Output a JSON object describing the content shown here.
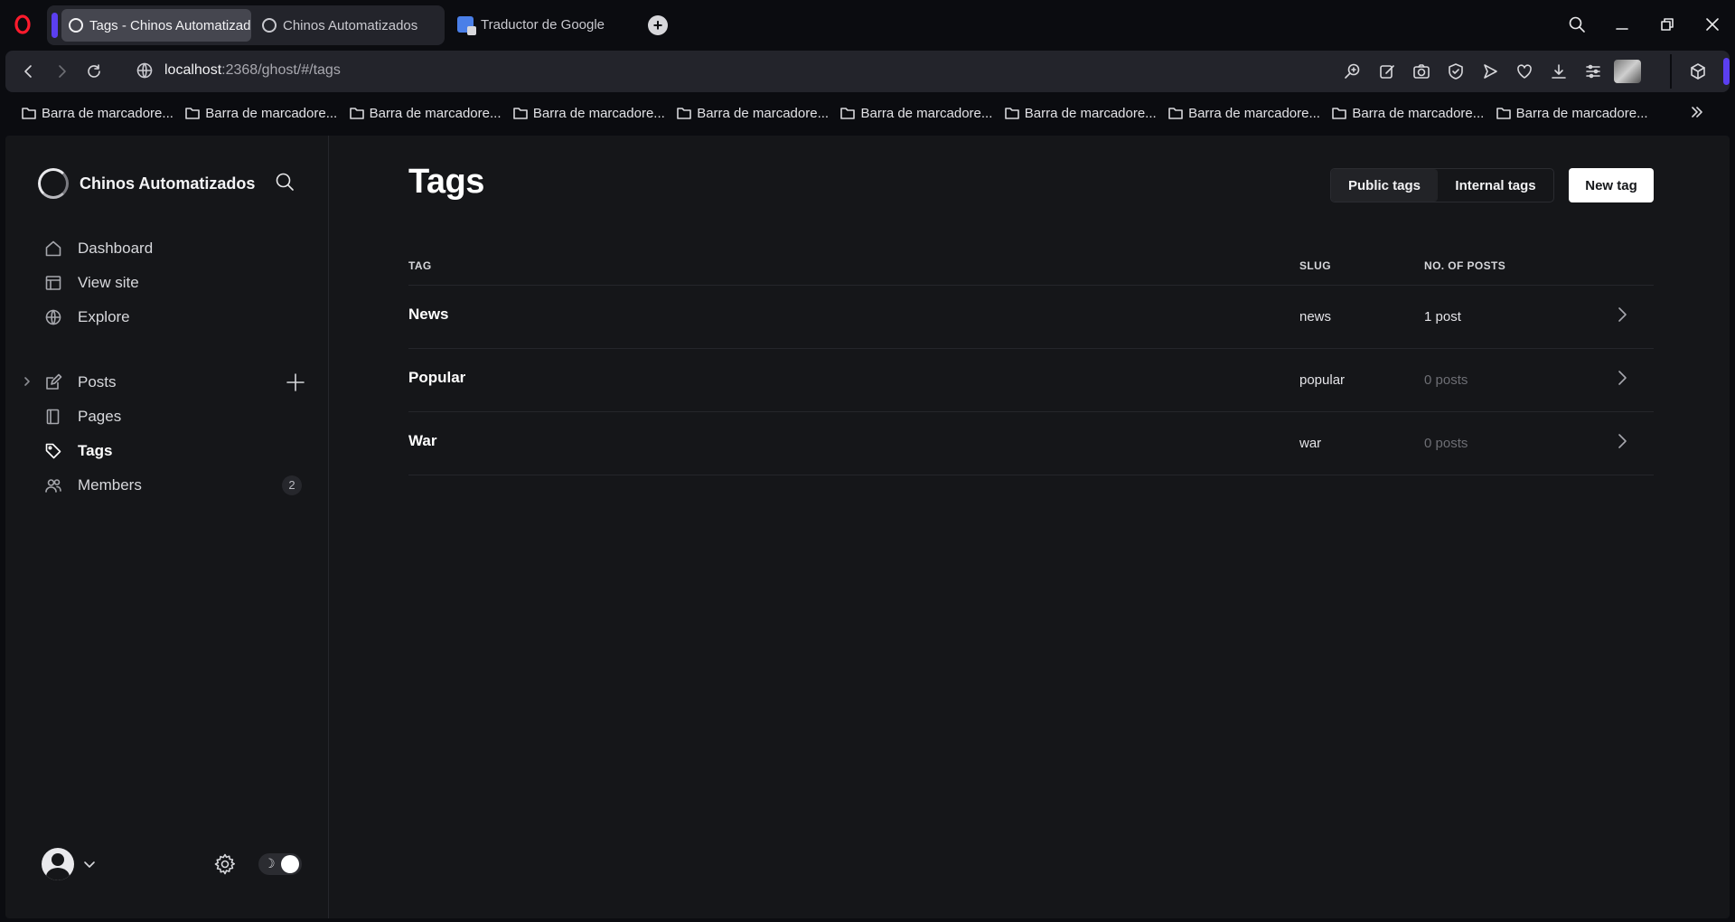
{
  "browser": {
    "tabs": [
      {
        "title": "Tags - Chinos Automatizados",
        "active": true
      },
      {
        "title": "Chinos Automatizados",
        "active": false
      },
      {
        "title": "Traductor de Google",
        "active": false
      }
    ],
    "url_host": "localhost",
    "url_rest": ":2368/ghost/#/tags",
    "bookmarks": [
      "Barra de marcadore...",
      "Barra de marcadore...",
      "Barra de marcadore...",
      "Barra de marcadore...",
      "Barra de marcadore...",
      "Barra de marcadore...",
      "Barra de marcadore...",
      "Barra de marcadore...",
      "Barra de marcadore...",
      "Barra de marcadore..."
    ],
    "accent_color": "#5b3ff0"
  },
  "sidebar": {
    "site_name": "Chinos Automatizados",
    "items": [
      {
        "label": "Dashboard",
        "icon": "home-icon"
      },
      {
        "label": "View site",
        "icon": "layout-icon"
      },
      {
        "label": "Explore",
        "icon": "globe-icon"
      },
      {
        "label": "Posts",
        "icon": "edit-icon"
      },
      {
        "label": "Pages",
        "icon": "page-icon"
      },
      {
        "label": "Tags",
        "icon": "tag-icon",
        "active": true
      },
      {
        "label": "Members",
        "icon": "members-icon",
        "count": "2"
      }
    ],
    "theme_icon": "☽"
  },
  "main": {
    "title": "Tags",
    "filter_public": "Public tags",
    "filter_internal": "Internal tags",
    "new_tag": "New tag",
    "columns": {
      "tag": "TAG",
      "slug": "SLUG",
      "posts": "NO. OF POSTS"
    },
    "rows": [
      {
        "name": "News",
        "slug": "news",
        "posts": "1 post"
      },
      {
        "name": "Popular",
        "slug": "popular",
        "posts": "0 posts"
      },
      {
        "name": "War",
        "slug": "war",
        "posts": "0 posts"
      }
    ]
  }
}
